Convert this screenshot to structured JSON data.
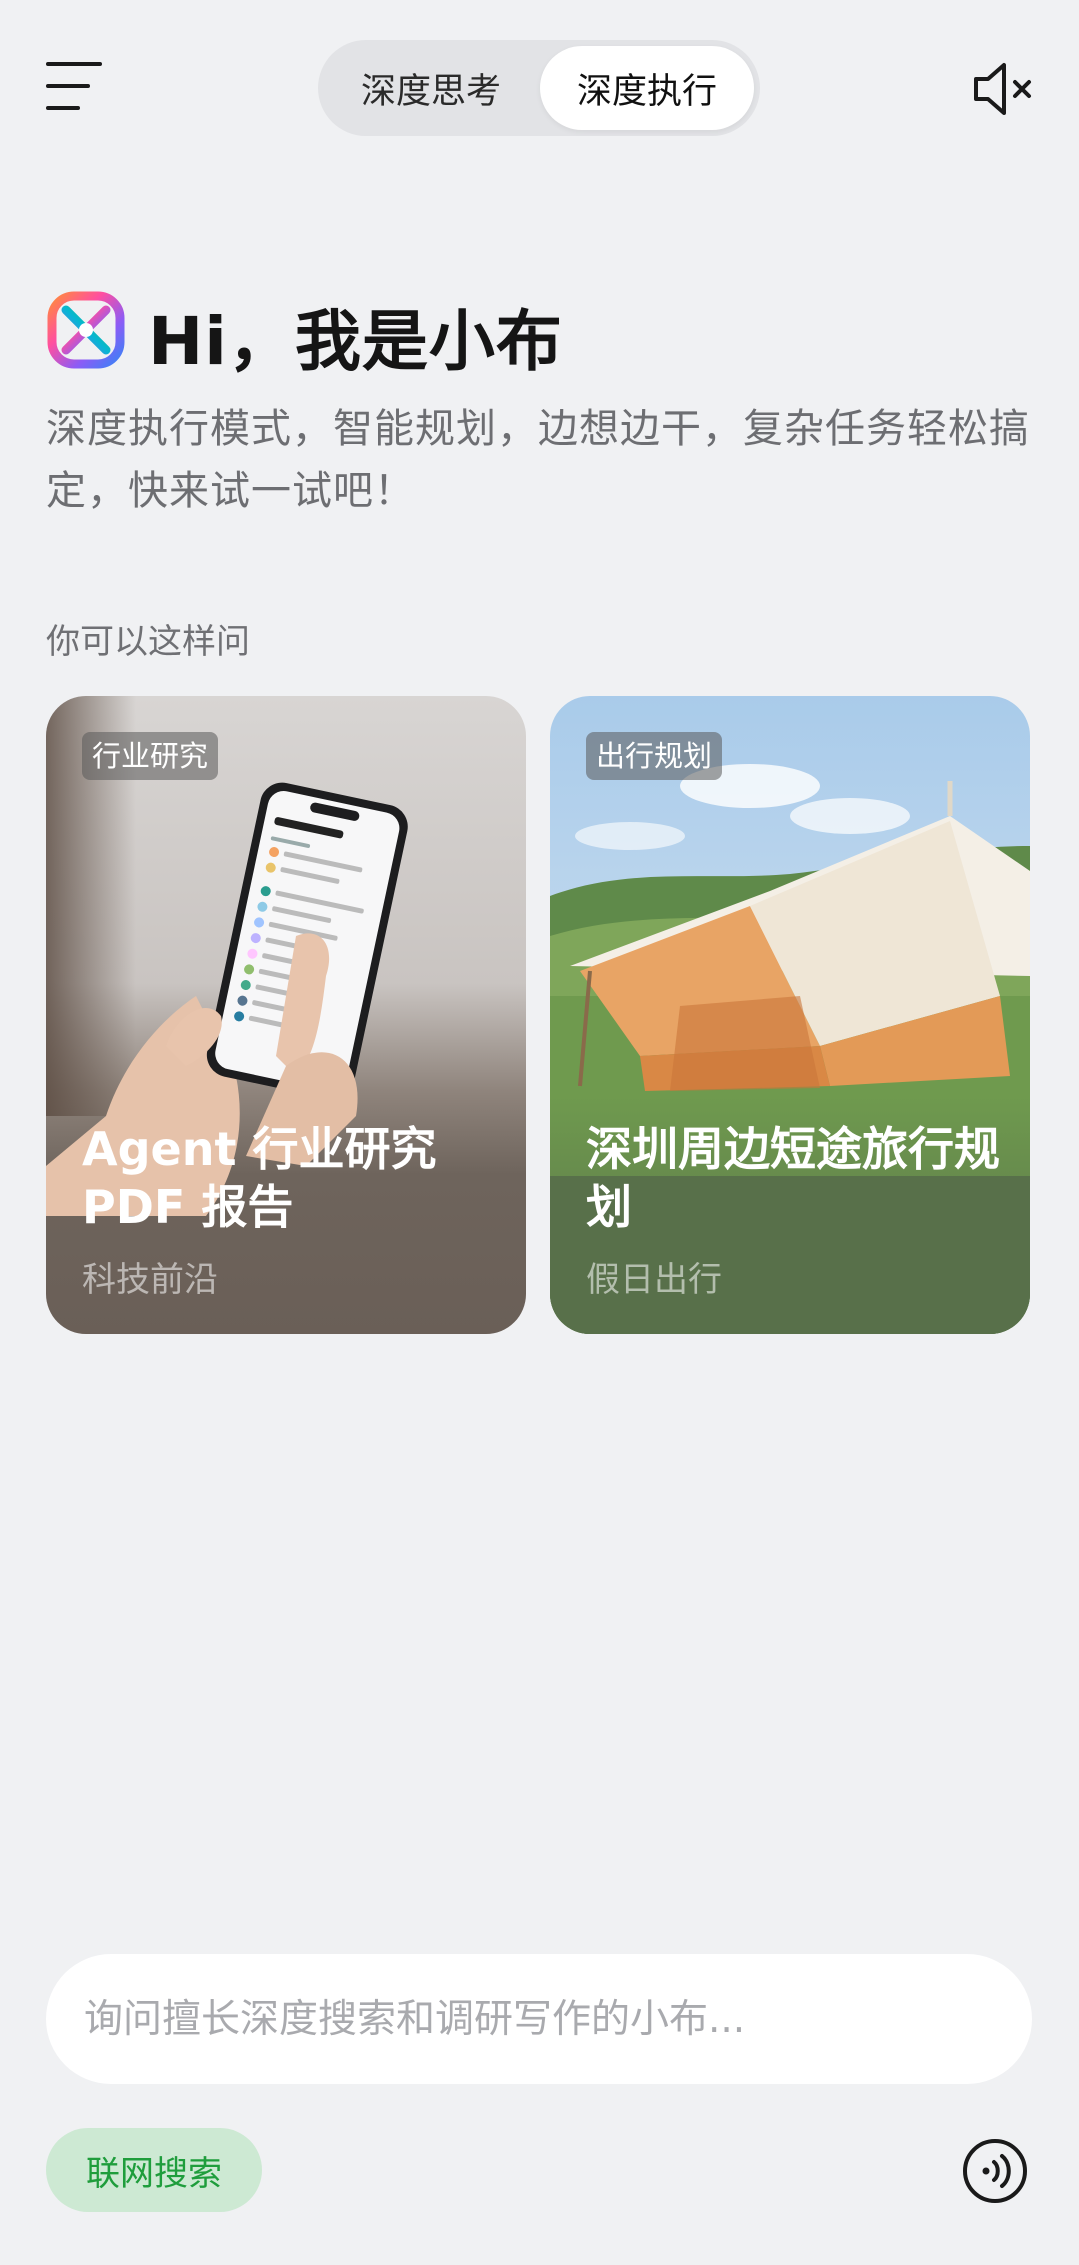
{
  "header": {
    "mode_options": [
      "深度思考",
      "深度执行"
    ],
    "selected_mode": "深度执行",
    "menu_icon": "menu-icon",
    "mute_icon": "speaker-muted-icon"
  },
  "greeting": {
    "logo_icon": "xiaobu-logo-icon",
    "title": "Hi，我是小布",
    "subtitle": "深度执行模式，智能规划，边想边干，复杂任务轻松搞定，快来试一试吧！"
  },
  "suggestions": {
    "label": "你可以这样问",
    "cards": [
      {
        "tag": "行业研究",
        "title": "Agent 行业研究 PDF 报告",
        "subtitle": "科技前沿"
      },
      {
        "tag": "出行规划",
        "title": "深圳周边短途旅行规划",
        "subtitle": "假日出行"
      }
    ]
  },
  "composer": {
    "placeholder": "询问擅长深度搜索和调研写作的小布...",
    "value": "",
    "web_search_label": "联网搜索",
    "voice_icon": "voice-input-icon"
  },
  "colors": {
    "background": "#f0f1f3",
    "accent_green": "#1f9d3c",
    "chip_green_bg": "#cde9d3"
  }
}
